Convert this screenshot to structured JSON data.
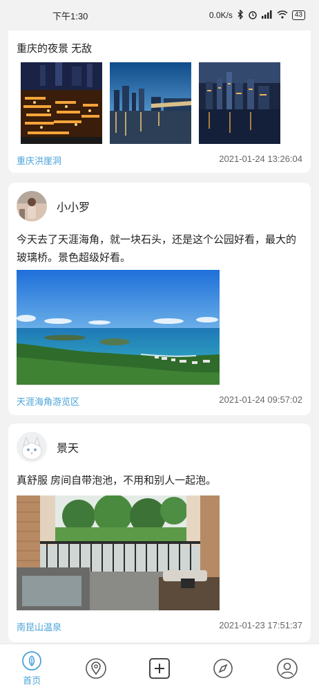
{
  "status_bar": {
    "time": "下午1:30",
    "network_speed": "0.0K/s",
    "battery": "43"
  },
  "posts": [
    {
      "text": "重庆的夜景 无敌",
      "location": "重庆洪崖洞",
      "time": "2021-01-24 13:26:04"
    },
    {
      "username": "小小罗",
      "text": "今天去了天涯海角，就一块石头，还是这个公园好看，最大的玻璃桥。景色超级好看。",
      "location": "天涯海角游览区",
      "time": "2021-01-24 09:57:02"
    },
    {
      "username": "景天",
      "text": "真舒服 房间自带泡池，不用和别人一起泡。",
      "location": "南昆山温泉",
      "time": "2021-01-23 17:51:37"
    }
  ],
  "tabs": [
    {
      "label": "首页",
      "icon": "home-icon"
    },
    {
      "icon": "location-icon"
    },
    {
      "icon": "add-icon"
    },
    {
      "icon": "compass-icon"
    },
    {
      "icon": "profile-icon"
    }
  ],
  "colors": {
    "accent": "#4aa3d8",
    "background": "#f2f2f2",
    "card": "#ffffff"
  }
}
